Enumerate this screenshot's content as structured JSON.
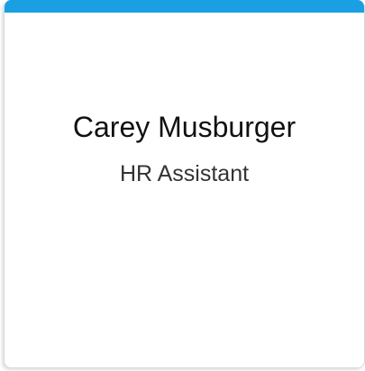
{
  "card": {
    "accent_color": "#1aa0e2",
    "name": "Carey Musburger",
    "title": "HR Assistant"
  }
}
